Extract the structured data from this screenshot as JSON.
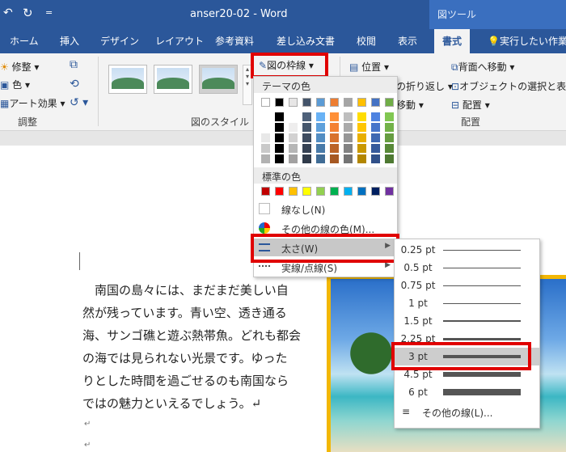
{
  "titlebar": {
    "undo_icon": "undo-icon",
    "redo_icon": "redo-icon",
    "qat": "=",
    "doc_title": "anser20-02 - Word",
    "context_tab": "図ツール"
  },
  "tabs": [
    "ホーム",
    "挿入",
    "デザイン",
    "レイアウト",
    "参考資料",
    "差し込み文書",
    "校閲",
    "表示",
    "書式"
  ],
  "tell_me": "実行したい作業を",
  "ribbon": {
    "adjust": {
      "corrections": "修整",
      "color": "色",
      "effects": "アート効果",
      "label": "調整"
    },
    "styles": {
      "label": "図のスタイル"
    },
    "border_button": "図の枠線",
    "arrange": {
      "position": "位置",
      "wrap": "の折り返し",
      "forward": "前面へ移動",
      "bring_front": "背面へ移動",
      "select_pane": "オブジェクトの選択と表示",
      "align": "配置",
      "move": "移動",
      "label": "配置"
    }
  },
  "border_menu": {
    "theme_colors_header": "テーマの色",
    "theme_colors": [
      "#ffffff",
      "#000000",
      "#e7e6e6",
      "#44546a",
      "#5b9bd5",
      "#ed7d31",
      "#a5a5a5",
      "#ffc000",
      "#4472c4",
      "#70ad47"
    ],
    "standard_colors_header": "標準の色",
    "standard_colors": [
      "#c00000",
      "#ff0000",
      "#ffc000",
      "#ffff00",
      "#92d050",
      "#00b050",
      "#00b0f0",
      "#0070c0",
      "#002060",
      "#7030a0"
    ],
    "no_line": "線なし(N)",
    "more_colors": "その他の線の色(M)...",
    "weight": "太さ(W)",
    "dashes": "実線/点線(S)"
  },
  "weight_menu": {
    "options": [
      {
        "label": "0.25 pt",
        "value": 0.25
      },
      {
        "label": "0.5 pt",
        "value": 0.5
      },
      {
        "label": "0.75 pt",
        "value": 0.75
      },
      {
        "label": "1 pt",
        "value": 1
      },
      {
        "label": "1.5 pt",
        "value": 1.5
      },
      {
        "label": "2.25 pt",
        "value": 2.25
      },
      {
        "label": "3 pt",
        "value": 3
      },
      {
        "label": "4.5 pt",
        "value": 4.5
      },
      {
        "label": "6 pt",
        "value": 6
      }
    ],
    "selected": "3 pt",
    "more_lines": "その他の線(L)..."
  },
  "document": {
    "lines": [
      "南国の島々には、まだまだ美しい自",
      "然が残っています。青い空、透き通る",
      "海、サンゴ礁と遊ぶ熱帯魚。どれも都会",
      "の海では見られない光景です。ゆった",
      "りとした時間を過ごせるのも南国なら",
      "ではの魅力といえるでしょう。↵"
    ],
    "return_mark": "↵"
  },
  "colors": {
    "accent": "#2b579a",
    "highlight": "#e00000",
    "photo_border": "#f2b705"
  }
}
